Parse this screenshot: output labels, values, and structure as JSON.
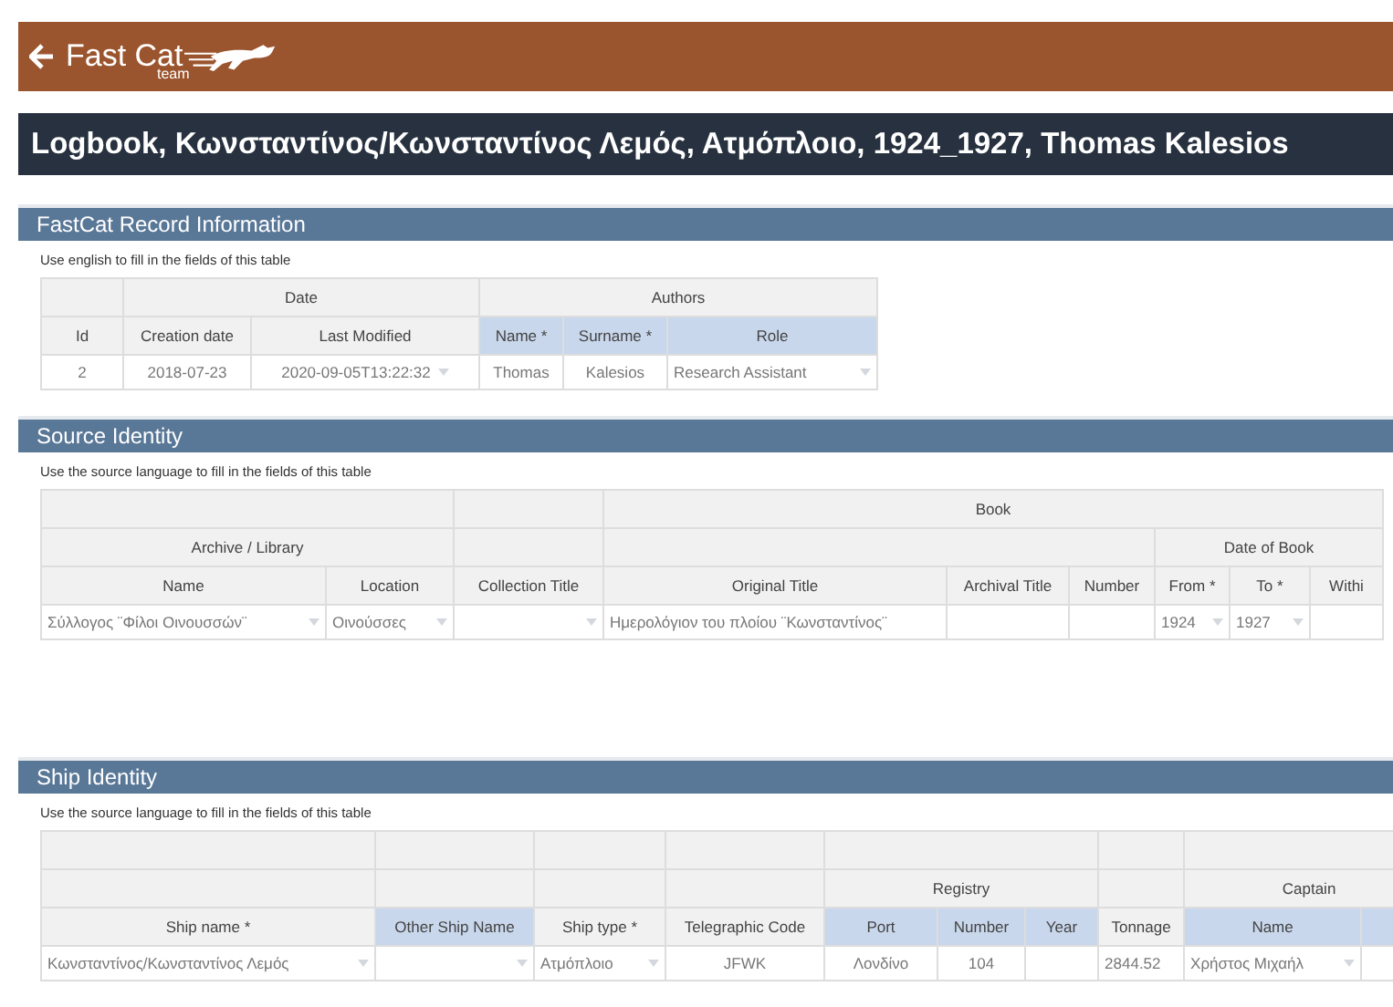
{
  "header": {
    "logo_text": "Fast Cat",
    "logo_subtext": "team"
  },
  "title": "Logbook, Κωνσταντίνος/Κωνσταντίνος Λεμός, Ατμόπλοιο, 1924_1927, Thomas Kalesios",
  "sections": [
    {
      "title": "FastCat Record Information",
      "note": "Use english to fill in the fields of this table",
      "table": {
        "header_rows": [
          [
            {
              "highlight": false
            },
            {
              "text": "Date",
              "highlight": false
            },
            {
              "text": "Authors",
              "highlight": false
            }
          ],
          [
            {
              "text": "Id",
              "highlight": false
            },
            {
              "text": "Creation date",
              "highlight": false
            },
            {
              "text": "Last Modified",
              "highlight": false
            },
            {
              "text": "Name *",
              "highlight": true
            },
            {
              "text": "Surname *",
              "highlight": true
            },
            {
              "text": "Role",
              "highlight": true
            }
          ]
        ],
        "rows": [
          [
            {
              "text": "2",
              "dropdown": false
            },
            {
              "text": "2018-07-23",
              "dropdown": false
            },
            {
              "text": "2020-09-05T13:22:32",
              "dropdown": true
            },
            {
              "text": "Thomas",
              "dropdown": false
            },
            {
              "text": "Kalesios",
              "dropdown": false
            },
            {
              "text": "Research Assistant",
              "dropdown": true
            }
          ]
        ]
      }
    },
    {
      "title": "Source Identity",
      "note": "Use the source language to fill in the fields of this table",
      "table": {
        "header_rows": [
          [
            {
              "highlight": false
            },
            {
              "highlight": false
            },
            {
              "text": "Book",
              "highlight": false
            }
          ],
          [
            {
              "text": "Archive / Library",
              "highlight": false
            },
            {
              "highlight": false
            },
            {
              "highlight": false
            },
            {
              "text": "Date of Book",
              "highlight": false
            }
          ],
          [
            {
              "text": "Name",
              "highlight": false
            },
            {
              "text": "Location",
              "highlight": false
            },
            {
              "text": "Collection Title",
              "highlight": false
            },
            {
              "text": "Original Title",
              "highlight": false
            },
            {
              "text": "Archival Title",
              "highlight": false
            },
            {
              "text": "Number",
              "highlight": false
            },
            {
              "text": "From *",
              "highlight": false
            },
            {
              "text": "To *",
              "highlight": false
            },
            {
              "text": "Withi",
              "highlight": false
            }
          ]
        ],
        "rows": [
          [
            {
              "text": "Σύλλογος ¨Φίλοι Οινουσσών¨",
              "dropdown": true
            },
            {
              "text": "Οινούσσες",
              "dropdown": true
            },
            {
              "dropdown": true
            },
            {
              "text": "Ημερολόγιον του πλοίου ¨Κωνσταντίνος¨",
              "dropdown": false
            },
            {
              "dropdown": false
            },
            {
              "dropdown": false
            },
            {
              "text": "1924",
              "dropdown": true
            },
            {
              "text": "1927",
              "dropdown": true
            },
            {
              "dropdown": false
            }
          ]
        ]
      }
    },
    {
      "title": "Ship Identity",
      "note": "Use the source language to fill in the fields of this table",
      "table": {
        "header_rows": [
          [
            {
              "highlight": false
            },
            {
              "highlight": false
            },
            {
              "highlight": false
            },
            {
              "highlight": false
            },
            {
              "highlight": false
            },
            {
              "highlight": false
            },
            {
              "highlight": false
            }
          ],
          [
            {
              "highlight": false
            },
            {
              "highlight": false
            },
            {
              "highlight": false
            },
            {
              "highlight": false
            },
            {
              "text": "Registry",
              "highlight": false
            },
            {
              "highlight": false
            },
            {
              "text": "Captain",
              "highlight": false
            }
          ],
          [
            {
              "text": "Ship name *",
              "highlight": false
            },
            {
              "text": "Other Ship Name",
              "highlight": true
            },
            {
              "text": "Ship type *",
              "highlight": false
            },
            {
              "text": "Telegraphic Code",
              "highlight": false
            },
            {
              "text": "Port",
              "highlight": true
            },
            {
              "text": "Number",
              "highlight": true
            },
            {
              "text": "Year",
              "highlight": true
            },
            {
              "text": "Tonnage",
              "highlight": false
            },
            {
              "text": "Name",
              "highlight": true
            },
            {
              "highlight": true
            }
          ]
        ],
        "rows": [
          [
            {
              "text": "Κωνσταντίνος/Κωνσταντίνος Λεμός",
              "dropdown": true
            },
            {
              "dropdown": true
            },
            {
              "text": "Ατμόπλοιο",
              "dropdown": true
            },
            {
              "text": "JFWK",
              "dropdown": false
            },
            {
              "text": "Λονδίνο",
              "dropdown": false
            },
            {
              "text": "104",
              "dropdown": false
            },
            {
              "dropdown": false
            },
            {
              "text": "2844.52",
              "dropdown": false
            },
            {
              "text": "Χρήστος Μιχαήλ",
              "dropdown": true
            },
            {
              "dropdown": false
            }
          ]
        ]
      }
    }
  ]
}
